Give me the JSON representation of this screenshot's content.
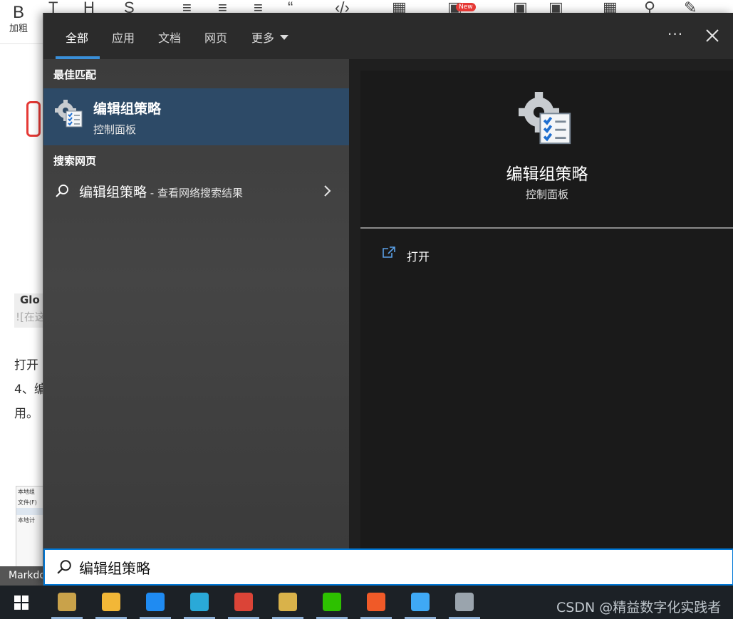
{
  "editor": {
    "bold_glyph": "B",
    "bold_label": "加粗",
    "new_badge": "New",
    "peek_gl": "Glo",
    "peek_placeholder": "![在这",
    "peek_line1": "打开",
    "peek_line2": "4、编",
    "peek_line3": "用。",
    "thumb_line1": "本地组",
    "thumb_line2": "文件(F)",
    "thumb_line3": "本地计",
    "status_tab": "Markdown"
  },
  "start_menu": {
    "tabs": [
      {
        "label": "全部",
        "active": true
      },
      {
        "label": "应用"
      },
      {
        "label": "文档"
      },
      {
        "label": "网页"
      },
      {
        "label": "更多"
      }
    ],
    "best_match_heading": "最佳匹配",
    "best_match": {
      "title": "编辑组策略",
      "subtitle": "控制面板",
      "icon": "group-policy-gear-icon"
    },
    "web_heading": "搜索网页",
    "web_result": {
      "query": "编辑组策略",
      "suffix": " - 查看网络搜索结果"
    },
    "preview": {
      "title": "编辑组策略",
      "subtitle": "控制面板",
      "open_label": "打开"
    },
    "search": {
      "value": "编辑组策略"
    },
    "accent": "#0078d7"
  },
  "taskbar": {
    "apps": [
      {
        "name": "tools-app",
        "color": "#c9a24a"
      },
      {
        "name": "file-explorer",
        "color": "#f2b737"
      },
      {
        "name": "feishu-app",
        "color": "#1f8bf2"
      },
      {
        "name": "hbuilder-app",
        "color": "#2aa9d8"
      },
      {
        "name": "chrome-browser",
        "color": "#db4437"
      },
      {
        "name": "dev-tools-app",
        "color": "#d9b24a"
      },
      {
        "name": "wechat-app",
        "color": "#2dc100"
      },
      {
        "name": "xmind-app",
        "color": "#f05a28"
      },
      {
        "name": "control-panel-app",
        "color": "#3fa9f5"
      },
      {
        "name": "group-policy-app",
        "color": "#9aa4ad"
      }
    ],
    "watermark": "CSDN @精益数字化实践者"
  }
}
